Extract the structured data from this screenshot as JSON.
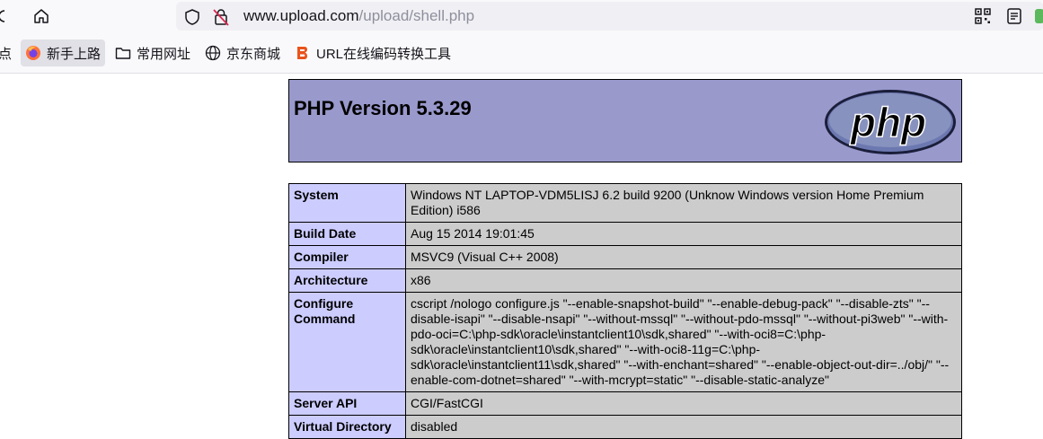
{
  "browser": {
    "url_host": "www.upload.com",
    "url_path": "/upload/shell.php",
    "bookmarks": [
      {
        "label": "点",
        "icon": "partial-bookmark-icon"
      },
      {
        "label": "新手上路",
        "icon": "firefox-icon"
      },
      {
        "label": "常用网址",
        "icon": "folder-icon"
      },
      {
        "label": "京东商城",
        "icon": "globe-icon"
      },
      {
        "label": "URL在线编码转换工具",
        "icon": "tool-logo-icon"
      }
    ]
  },
  "header": {
    "title": "PHP Version 5.3.29",
    "logo_text": "php"
  },
  "info_rows": [
    {
      "key": "System",
      "value": "Windows NT LAPTOP-VDM5LISJ 6.2 build 9200 (Unknow Windows version Home Premium Edition) i586"
    },
    {
      "key": "Build Date",
      "value": "Aug 15 2014 19:01:45"
    },
    {
      "key": "Compiler",
      "value": "MSVC9 (Visual C++ 2008)"
    },
    {
      "key": "Architecture",
      "value": "x86"
    },
    {
      "key": "Configure Command",
      "value": "cscript /nologo configure.js \"--enable-snapshot-build\" \"--enable-debug-pack\" \"--disable-zts\" \"--disable-isapi\" \"--disable-nsapi\" \"--without-mssql\" \"--without-pdo-mssql\" \"--without-pi3web\" \"--with-pdo-oci=C:\\php-sdk\\oracle\\instantclient10\\sdk,shared\" \"--with-oci8=C:\\php-sdk\\oracle\\instantclient10\\sdk,shared\" \"--with-oci8-11g=C:\\php-sdk\\oracle\\instantclient11\\sdk,shared\" \"--with-enchant=shared\" \"--enable-object-out-dir=../obj/\" \"--enable-com-dotnet=shared\" \"--with-mcrypt=static\" \"--disable-static-analyze\""
    },
    {
      "key": "Server API",
      "value": "CGI/FastCGI"
    },
    {
      "key": "Virtual Directory",
      "value": "disabled"
    }
  ],
  "colors": {
    "header_bg": "#9999cc",
    "key_bg": "#ccccff",
    "value_bg": "#cccccc"
  }
}
